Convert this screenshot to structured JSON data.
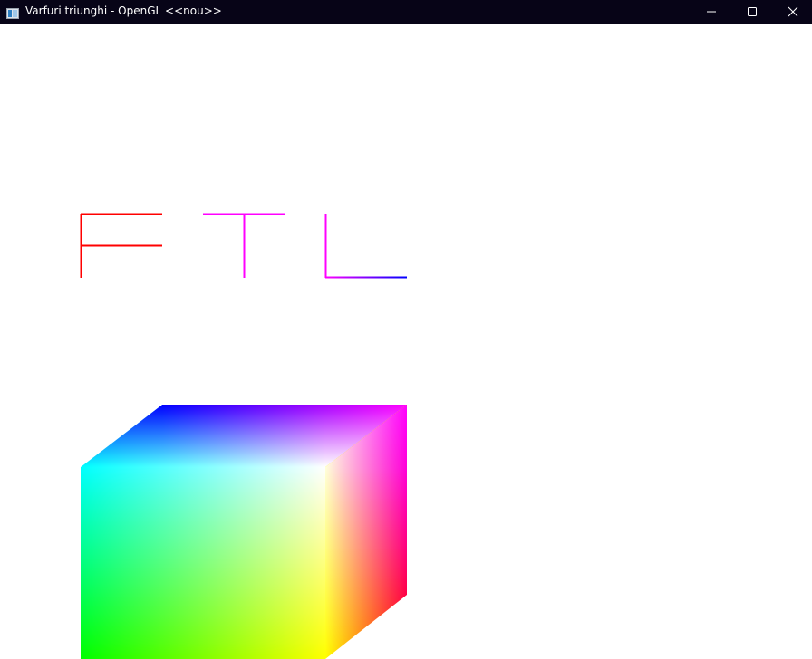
{
  "window": {
    "title": "Varfuri triunghi - OpenGL <<nou>>",
    "title_bar_color": "#070417",
    "background_color": "#ffffff"
  },
  "caption_buttons": {
    "minimize_icon": "minimize-icon",
    "maximize_icon": "maximize-icon",
    "close_icon": "close-icon"
  },
  "scene": {
    "letters": [
      "F",
      "T",
      "L"
    ],
    "letter_colors": {
      "F": "#ff0000",
      "T": "#ff00ff",
      "L_vertical": "#ff00ff",
      "L_horizontal_start": "#ff00ff",
      "L_horizontal_end": "#0000ff"
    },
    "cube_vertex_colors": {
      "front_top_left": "#00ffff",
      "front_top_right": "#ffffff",
      "front_bottom_left": "#00ff00",
      "front_bottom_right": "#ffff00",
      "back_top_left": "#0000ff",
      "back_top_right": "#ff00ff",
      "back_bottom_right": "#ff0000"
    }
  }
}
